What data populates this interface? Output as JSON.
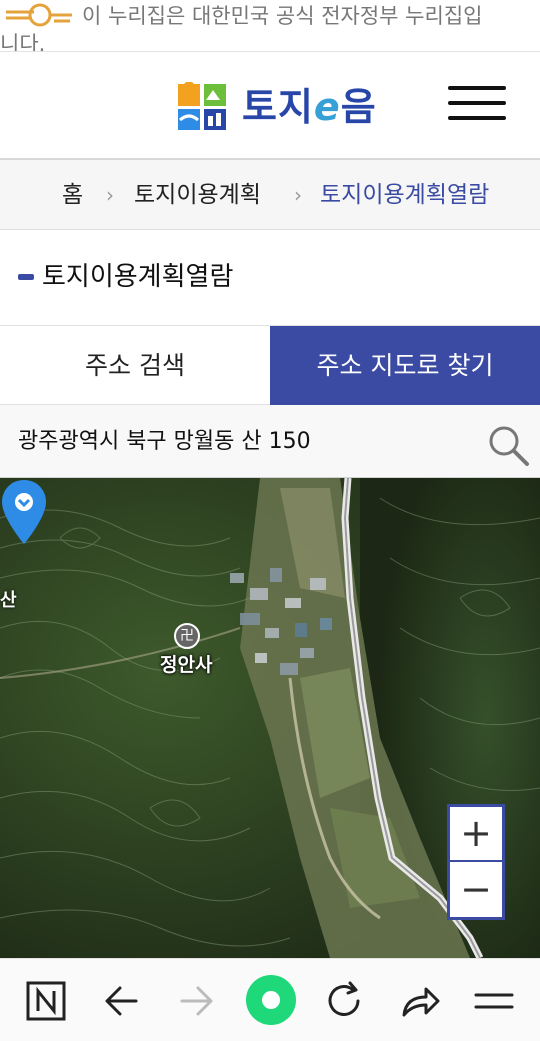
{
  "gov_banner": {
    "logo_icon": "eg-government-logo",
    "line1": "이 누리집은 대한민국 공식 전자정부 누리집입",
    "line2": "니다."
  },
  "header": {
    "logo_text_a": "토지",
    "logo_text_e": "e",
    "logo_text_b": "음",
    "menu_icon": "hamburger-menu-icon"
  },
  "breadcrumb": {
    "home": "홈",
    "level1": "토지이용계획",
    "current": "토지이용계획열람"
  },
  "page": {
    "title": "토지이용계획열람"
  },
  "tabs": [
    {
      "label": "주소 검색",
      "active": false
    },
    {
      "label": "주소 지도로 찾기",
      "active": true
    }
  ],
  "address_bar": {
    "value": "광주광역시 북구 망월동 산 150",
    "search_icon": "search-icon"
  },
  "map": {
    "temple_label": "정안사",
    "temple_symbol": "卍",
    "edge_label": "산",
    "zoom_in": "+",
    "zoom_out": "−"
  },
  "browser": {
    "icons": [
      "naver-n-icon",
      "back-arrow-icon",
      "forward-arrow-icon",
      "home-dot-icon",
      "reload-icon",
      "share-icon",
      "menu-icon"
    ]
  },
  "colors": {
    "accent": "#3b4ba3",
    "logo_blue": "#2746a8",
    "pin_blue": "#2f8ce6",
    "browser_green": "#1fd87a"
  }
}
